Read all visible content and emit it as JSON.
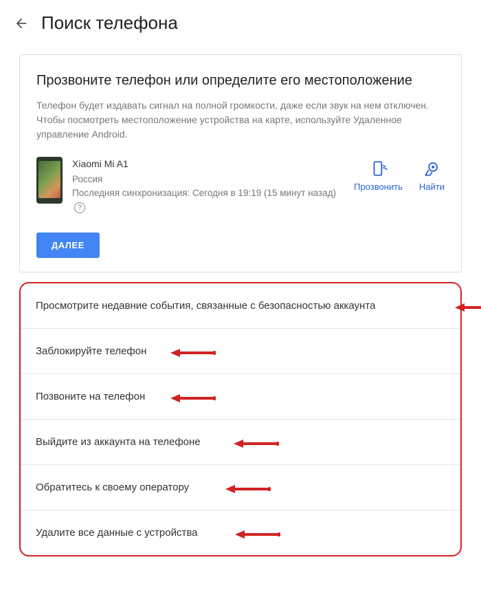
{
  "header": {
    "title": "Поиск телефона"
  },
  "main": {
    "section_title": "Прозвоните телефон или определите его местоположение",
    "section_desc": "Телефон будет издавать сигнал на полной громкости, даже если звук на нем отключен. Чтобы посмотреть местоположение устройства на карте, используйте Удаленное управление Android.",
    "device": {
      "name": "Xiaomi Mi A1",
      "location": "Россия",
      "sync": "Последняя синхронизация: Сегодня в 19:19 (15 минут назад)"
    },
    "actions": {
      "ring": "Прозвонить",
      "find": "Найти"
    },
    "next_label": "ДАЛЕЕ"
  },
  "options": [
    "Просмотрите недавние события, связанные с безопасностью аккаунта",
    "Заблокируйте телефон",
    "Позвоните на телефон",
    "Выйдите из аккаунта на телефоне",
    "Обратитесь к своему оператору",
    "Удалите все данные с устройства"
  ]
}
